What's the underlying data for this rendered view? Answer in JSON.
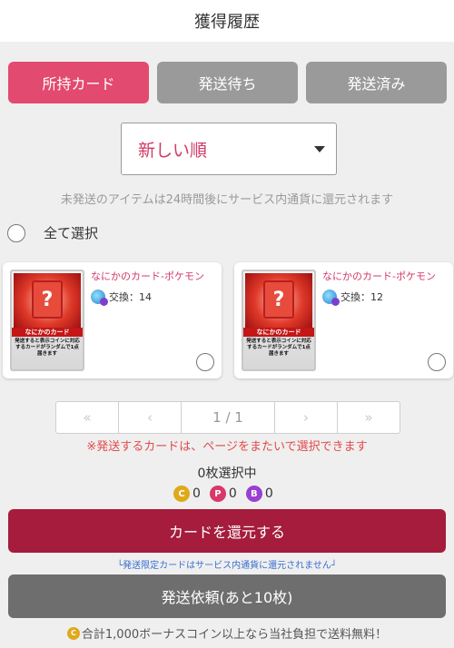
{
  "header": {
    "title": "獲得履歴"
  },
  "tabs": [
    {
      "label": "所持カード",
      "active": true
    },
    {
      "label": "発送待ち",
      "active": false
    },
    {
      "label": "発送済み",
      "active": false
    }
  ],
  "sort": {
    "selected": "新しい順"
  },
  "notice": "未発送のアイテムは24時間後にサービス内通貨に還元されます",
  "select_all": {
    "label": "全て選択"
  },
  "cards": [
    {
      "title": "なにかのカード-ポケモン",
      "exchange": "交換：14",
      "image": {
        "qmark": "?",
        "banner": "なにかのカード",
        "desc": "発送すると表示コインに対応するカードがランダムで1点届きます"
      }
    },
    {
      "title": "なにかのカード-ポケモン",
      "exchange": "交換：12",
      "image": {
        "qmark": "?",
        "banner": "なにかのカード",
        "desc": "発送すると表示コインに対応するカードがランダムで1点届きます"
      }
    }
  ],
  "pagination": {
    "first": "«",
    "prev": "‹",
    "current": "1 / 1",
    "next": "›",
    "last": "»"
  },
  "page_warning": "※発送するカードは、ページをまたいで選択できます",
  "selection": {
    "count_text": "0枚選択中",
    "coins": [
      {
        "icon": "C",
        "value": "0"
      },
      {
        "icon": "P",
        "value": "0"
      },
      {
        "icon": "B",
        "value": "0"
      }
    ]
  },
  "return_button": "カードを還元する",
  "return_note": "└発送限定カードはサービス内通貨に還元されません┘",
  "ship_button": "発送依頼(あと10枚)",
  "ship_note": {
    "icon": "C",
    "text": "合計1,000ボーナスコイン以上なら当社負担で送料無料！"
  },
  "colors": {
    "accent": "#e34a6f",
    "return": "#a51c3c",
    "warning": "#e34a4a"
  }
}
